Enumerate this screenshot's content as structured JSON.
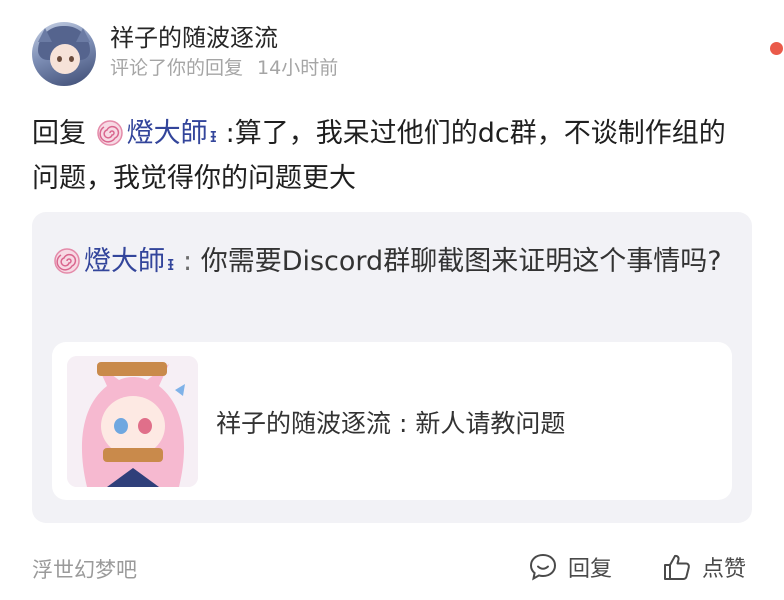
{
  "header": {
    "username": "祥子的随波逐流",
    "action": "评论了你的回复",
    "time": "14小时前"
  },
  "comment": {
    "prefix": "回复",
    "mention": "燈大師",
    "mention_badge": "ᵻ",
    "text": ":算了，我呆过他们的dc群，不谈制作组的问题，我觉得你的问题更大"
  },
  "quote": {
    "author": "燈大師",
    "author_badge": "ᵻ",
    "separator": " : ",
    "text": "你需要Discord群聊截图来证明这个事情吗?"
  },
  "post": {
    "text": "祥子的随波逐流 : 新人请教问题"
  },
  "footer": {
    "forum": "浮世幻梦吧",
    "reply_label": "回复",
    "like_label": "点赞"
  },
  "colors": {
    "mention": "#33459b",
    "unread_dot": "#ea5a4a",
    "quote_bg": "#f2f2f6",
    "meta_text": "#a5a5a5"
  }
}
